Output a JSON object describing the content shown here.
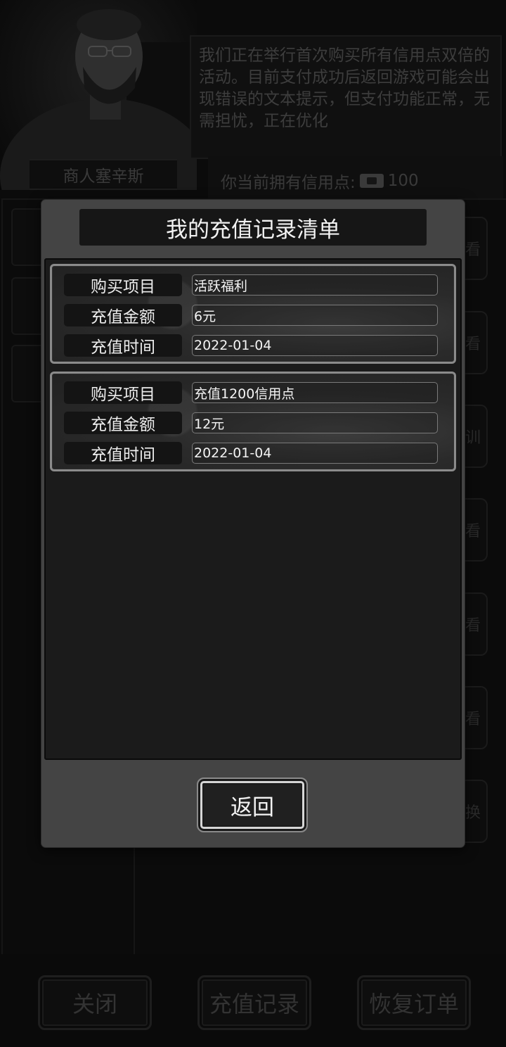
{
  "merchant": {
    "name": "商人塞辛斯",
    "dialog": "我们正在举行首次购买所有信用点双倍的活动。目前支付成功后返回游戏可能会出现错误的文本提示，但支付功能正常，无需担忧，正在优化",
    "credits_label": "你当前拥有信用点:",
    "credits_icon": "cash-icon",
    "credits_value": "100"
  },
  "side_buttons": [
    "看",
    "看",
    "训",
    "看",
    "看",
    "看",
    "换"
  ],
  "bottom_bar": {
    "close_label": "关闭",
    "records_label": "充值记录",
    "restore_label": "恢复订单"
  },
  "modal": {
    "title": "我的充值记录清单",
    "records": [
      {
        "item_label": "购买项目",
        "item_value": "活跃福利",
        "amount_label": "充值金额",
        "amount_value": "6元",
        "time_label": "充值时间",
        "time_value": "2022-01-04"
      },
      {
        "item_label": "购买项目",
        "item_value": "充值1200信用点",
        "amount_label": "充值金额",
        "amount_value": "12元",
        "time_label": "充值时间",
        "time_value": "2022-01-04"
      }
    ],
    "back_label": "返回"
  }
}
